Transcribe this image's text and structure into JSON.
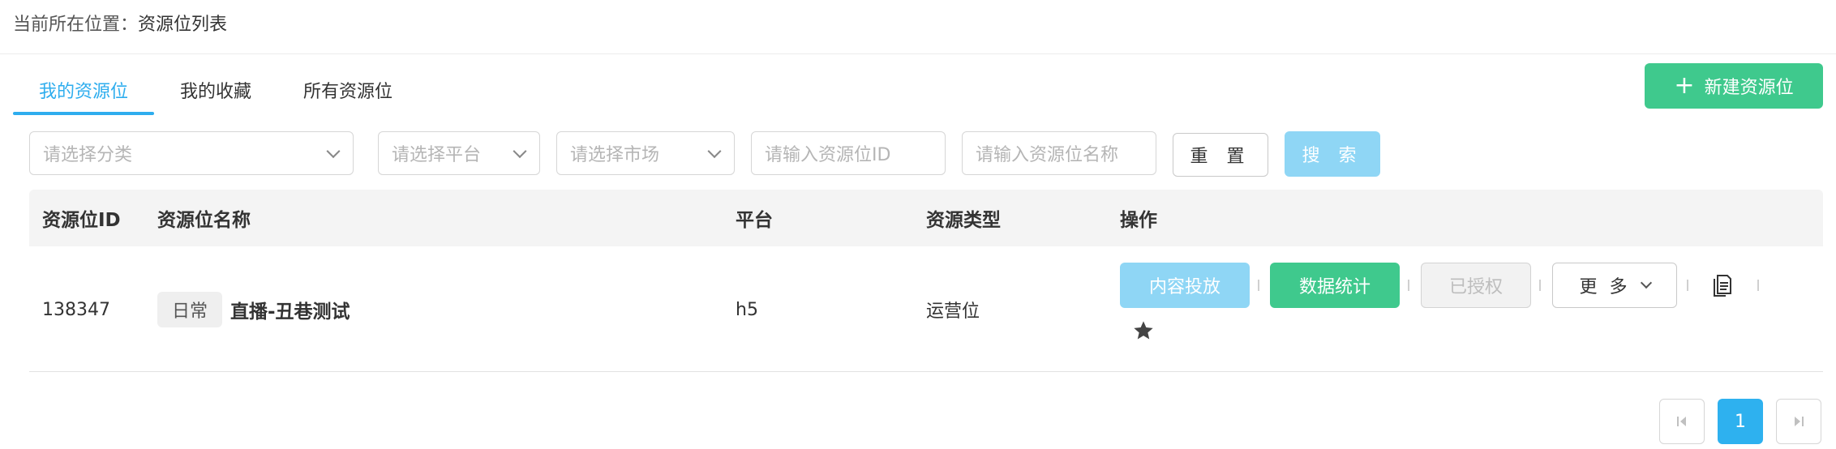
{
  "breadcrumb": {
    "prefix": "当前所在位置：",
    "current": "资源位列表"
  },
  "tabs": [
    {
      "label": "我的资源位",
      "active": true
    },
    {
      "label": "我的收藏",
      "active": false
    },
    {
      "label": "所有资源位",
      "active": false
    }
  ],
  "toolbar": {
    "new_label": "新建资源位",
    "new_icon": "plus-icon"
  },
  "filters": {
    "category_placeholder": "请选择分类",
    "platform_placeholder": "请选择平台",
    "market_placeholder": "请选择市场",
    "id_placeholder": "请输入资源位ID",
    "name_placeholder": "请输入资源位名称",
    "reset_label": "重 置",
    "search_label": "搜 索"
  },
  "table": {
    "columns": [
      "资源位ID",
      "资源位名称",
      "平台",
      "资源类型",
      "操作"
    ],
    "rows": [
      {
        "id": "138347",
        "tag": "日常",
        "name": "直播-丑巷测试",
        "platform": "h5",
        "type": "运营位",
        "actions": {
          "content": "内容投放",
          "stats": "数据统计",
          "authorized": "已授权",
          "more": "更 多",
          "copy_icon": "document-copy-icon",
          "favorite_icon": "star-icon"
        }
      }
    ]
  },
  "pagination": {
    "current_page": "1",
    "prev_icon": "first-page-icon",
    "next_icon": "last-page-icon"
  },
  "colors": {
    "accent": "#2eadee",
    "green": "#3fc98d",
    "light_blue": "#8fd6f5"
  }
}
